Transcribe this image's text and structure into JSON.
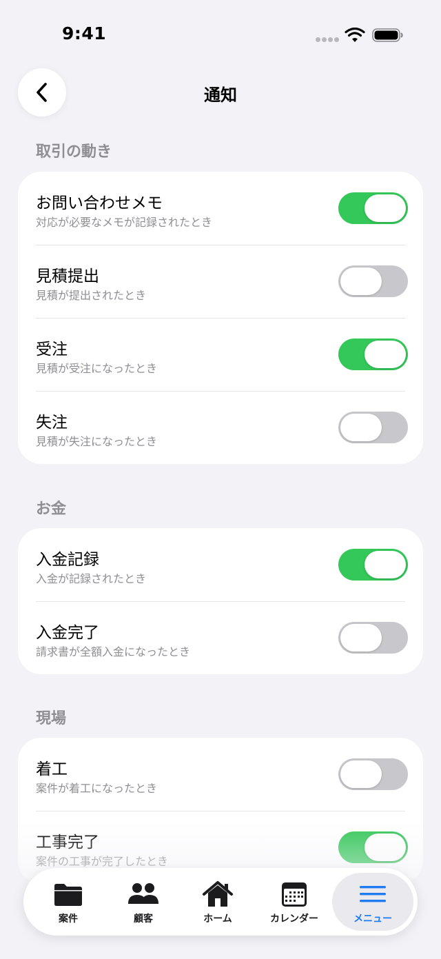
{
  "status_bar": {
    "time": "9:41"
  },
  "header": {
    "title": "通知"
  },
  "sections": [
    {
      "title": "取引の動き",
      "rows": [
        {
          "title": "お問い合わせメモ",
          "subtitle": "対応が必要なメモが記録されたとき",
          "enabled": true
        },
        {
          "title": "見積提出",
          "subtitle": "見積が提出されたとき",
          "enabled": false
        },
        {
          "title": "受注",
          "subtitle": "見積が受注になったとき",
          "enabled": true
        },
        {
          "title": "失注",
          "subtitle": "見積が失注になったとき",
          "enabled": false
        }
      ]
    },
    {
      "title": "お金",
      "rows": [
        {
          "title": "入金記録",
          "subtitle": "入金が記録されたとき",
          "enabled": true
        },
        {
          "title": "入金完了",
          "subtitle": "請求書が全額入金になったとき",
          "enabled": false
        }
      ]
    },
    {
      "title": "現場",
      "rows": [
        {
          "title": "着工",
          "subtitle": "案件が着工になったとき",
          "enabled": false
        },
        {
          "title": "工事完了",
          "subtitle": "案件の工事が完了したとき",
          "enabled": true
        }
      ]
    }
  ],
  "tab_bar": {
    "items": [
      {
        "label": "案件",
        "icon": "folder-icon"
      },
      {
        "label": "顧客",
        "icon": "people-icon"
      },
      {
        "label": "ホーム",
        "icon": "house-icon"
      },
      {
        "label": "カレンダー",
        "icon": "calendar-icon"
      },
      {
        "label": "メニュー",
        "icon": "menu-icon",
        "active": true
      }
    ]
  },
  "colors": {
    "toggle_on": "#34c759",
    "toggle_off": "#c8c8cc",
    "accent": "#1e7bf2",
    "background": "#f2f2f7"
  }
}
